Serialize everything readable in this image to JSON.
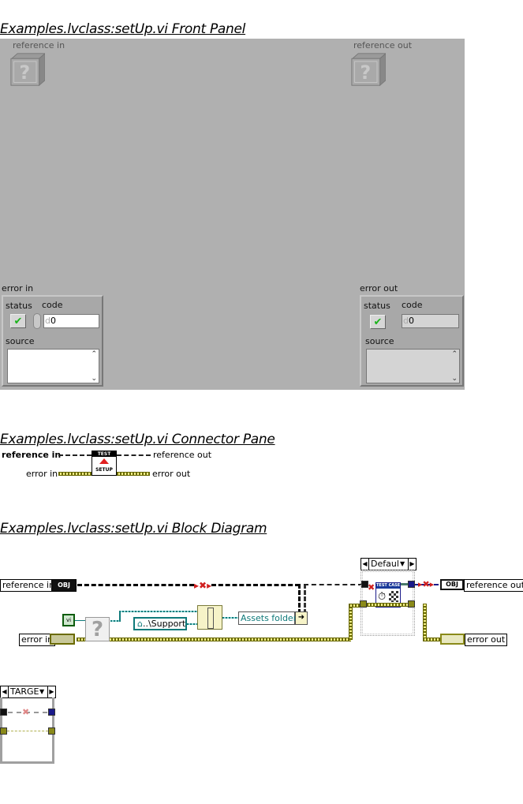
{
  "front_panel": {
    "title": "Examples.lvclass:setUp.vi Front Panel",
    "reference_in": {
      "label": "reference in",
      "icon": "question-cube-icon"
    },
    "reference_out": {
      "label": "reference out",
      "icon": "question-cube-icon"
    },
    "error_in": {
      "label": "error in",
      "status_label": "status",
      "status_value": "✔",
      "code_label": "code",
      "code_radix": "d",
      "code_value": "0",
      "source_label": "source",
      "source_value": ""
    },
    "error_out": {
      "label": "error out",
      "status_label": "status",
      "status_value": "✔",
      "code_label": "code",
      "code_radix": "d",
      "code_value": "0",
      "source_label": "source",
      "source_value": ""
    },
    "scroll_up": "⌃",
    "scroll_down": "⌄"
  },
  "connector_pane": {
    "title": "Examples.lvclass:setUp.vi Connector Pane",
    "reference_in": "reference in",
    "reference_out": "reference out",
    "error_in": "error in",
    "error_out": "error out",
    "icon_banner": "TEST",
    "icon_caption": "SETUP"
  },
  "block_diagram": {
    "title": "Examples.lvclass:setUp.vi Block Diagram",
    "reference_in": "reference in",
    "reference_out": "reference out",
    "error_in": "error in",
    "error_out": "error out",
    "obj_glyph": "OBJ",
    "path_constant": "..\\Support",
    "assets_folder": "Assets folder",
    "case_selector": "Defaul",
    "subvi_banner": "TEST CASE",
    "unknown_glyph": "?",
    "vi_glyph": "vi",
    "case_selector_2": "TARGE"
  }
}
